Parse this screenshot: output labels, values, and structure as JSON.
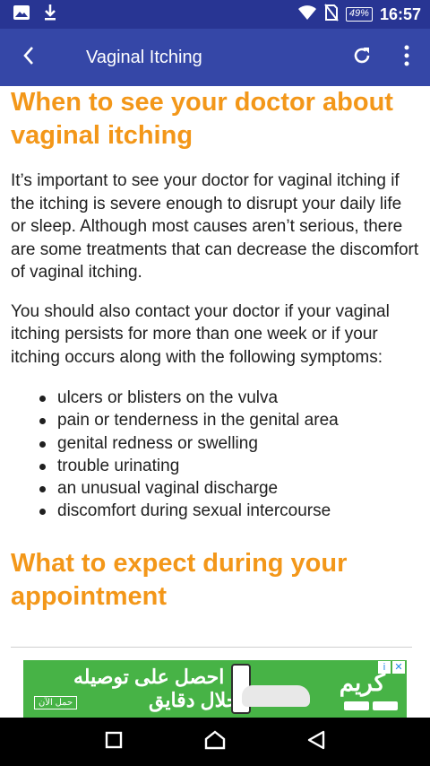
{
  "status_bar": {
    "battery": "49%",
    "time": "16:57"
  },
  "app_bar": {
    "title": "Vaginal Itching"
  },
  "article": {
    "heading1": "When to see your doctor about vaginal itching",
    "para1": "It’s important to see your doctor for vaginal itching if the itching is severe enough to disrupt your daily life or sleep. Although most causes aren’t serious, there are some treatments that can decrease the discomfort of vaginal itching.",
    "para2": "You should also contact your doctor if your vaginal itching persists for more than one week or if your itching occurs along with the following symptoms:",
    "symptoms": [
      "ulcers or blisters on the vulva",
      "pain or tenderness in the genital area",
      "genital redness or swelling",
      "trouble urinating",
      "an unusual vaginal discharge",
      "discomfort during sexual intercourse"
    ],
    "heading2": "What to expect during your appointment"
  },
  "ad": {
    "line1": "احصل على توصيله",
    "line2": "خلال دقايق",
    "brand": "كريم",
    "cta": "حمل الآن"
  },
  "colors": {
    "status_bar": "#283593",
    "app_bar": "#3547a7",
    "heading": "#f39719",
    "ad_bg": "#47b346"
  }
}
